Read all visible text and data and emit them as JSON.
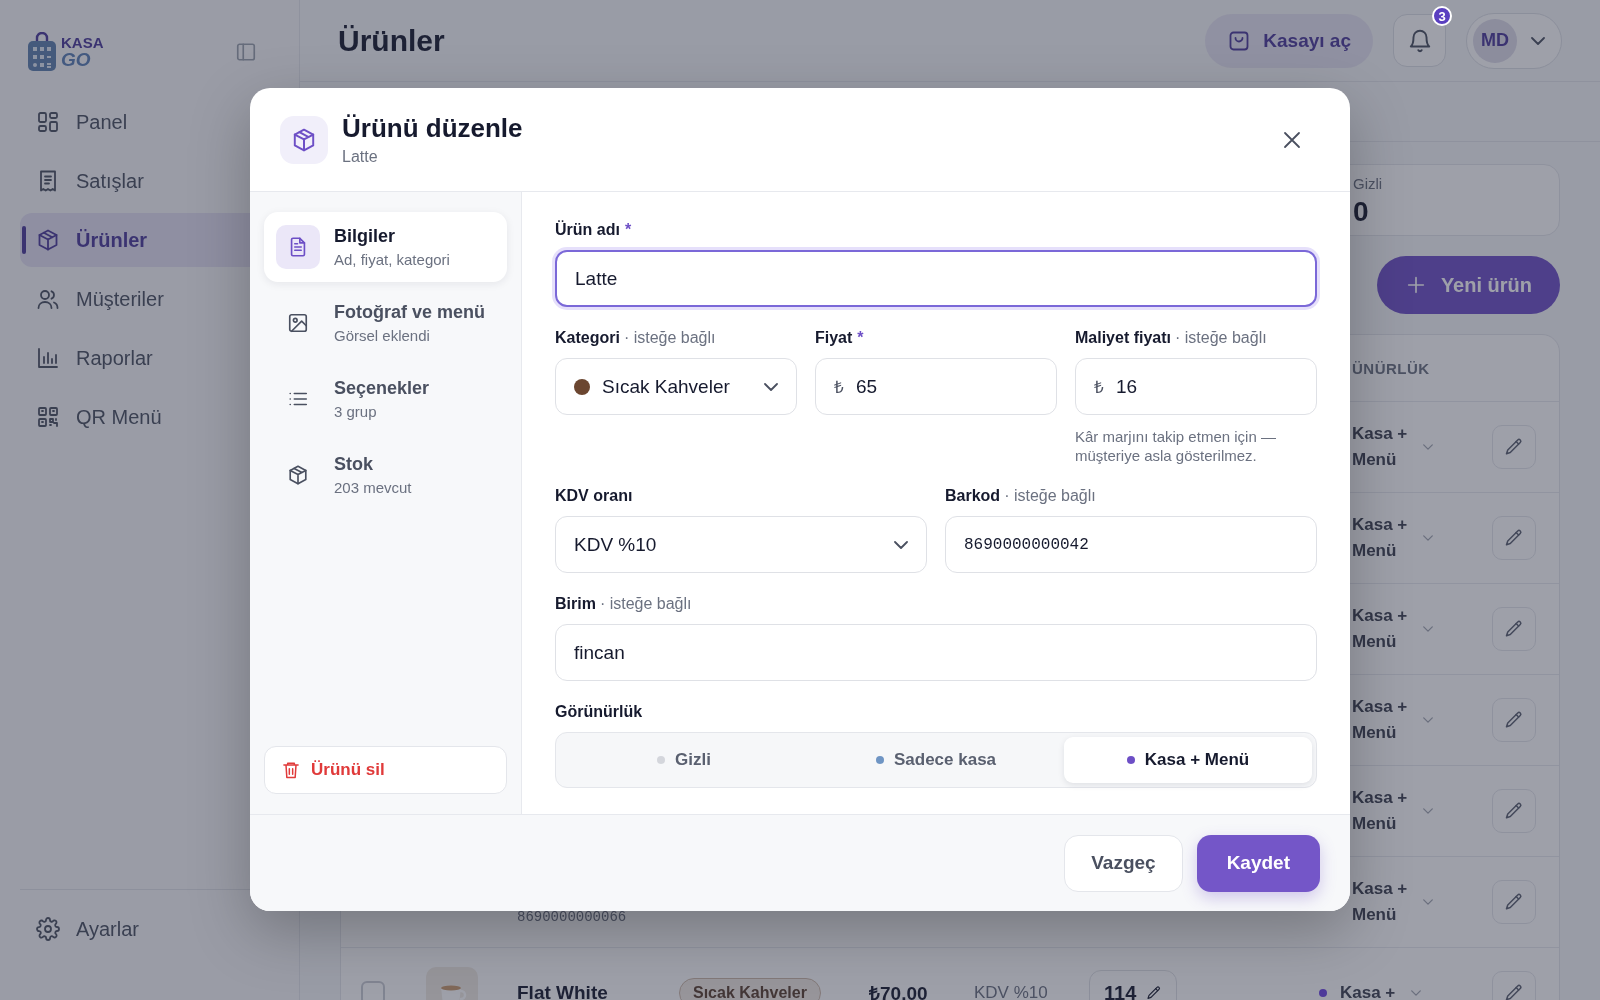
{
  "sidebar": {
    "logo": {
      "line_1": "KASA",
      "line_2": "GO"
    },
    "items": [
      {
        "label": "Panel",
        "selected": false
      },
      {
        "label": "Satışlar",
        "selected": false
      },
      {
        "label": "Ürünler",
        "selected": true
      },
      {
        "label": "Müşteriler",
        "selected": false
      },
      {
        "label": "Raporlar",
        "selected": false
      },
      {
        "label": "QR Menü",
        "selected": false
      }
    ],
    "footer_item": {
      "label": "Ayarlar"
    }
  },
  "header": {
    "title": "Ürünler",
    "open_register_button": "Kasayı aç",
    "notification_count": "3",
    "avatar_initials": "MD"
  },
  "stats": [
    {
      "label": "Gizli",
      "value": "0"
    }
  ],
  "new_product_button": "Yeni ürün",
  "table": {
    "columns": [
      {
        "label": "ÜNÜRLÜK"
      }
    ],
    "rows": [
      {
        "visibility": "Kasa + Menü"
      },
      {
        "visibility": "Kasa + Menü"
      },
      {
        "visibility": "Kasa + Menü"
      },
      {
        "visibility": "Kasa + Menü"
      },
      {
        "visibility": "Kasa + Menü"
      },
      {
        "barcode": "8690000000066",
        "visibility": "Kasa + Menü"
      },
      {
        "checked": false,
        "name": "Flat White",
        "category": "Sıcak Kahveler",
        "price": "₺70.00",
        "vat": "KDV %10",
        "stock": "114",
        "visibility": "Kasa +",
        "color": "#4e3a9a"
      }
    ]
  },
  "modal": {
    "title": "Ürünü düzenle",
    "subtitle": "Latte",
    "sections": [
      {
        "title": "Bilgiler",
        "subtitle": "Ad, fiyat, kategori",
        "selected": true
      },
      {
        "title": "Fotoğraf ve menü",
        "subtitle": "Görsel eklendi",
        "selected": false
      },
      {
        "title": "Seçenekler",
        "subtitle": "3 grup",
        "selected": false
      },
      {
        "title": "Stok",
        "subtitle": "203 mevcut",
        "selected": false
      }
    ],
    "delete_button": "Ürünü sil",
    "field_rows": [
      [
        {
          "kind": "text",
          "label": "Ürün adı",
          "required_mark": "*",
          "value": "Latte",
          "focused": true
        }
      ],
      [
        {
          "kind": "select",
          "label": "Kategori",
          "note": "· isteğe bağlı",
          "value": "Sıcak Kahveler",
          "color": "#6b4630",
          "focused": false
        },
        {
          "kind": "money",
          "label": "Fiyat",
          "required_mark": "*",
          "prefix": "₺",
          "value": "65",
          "focused": false
        },
        {
          "kind": "money",
          "label": "Maliyet fiyatı",
          "note": "· isteğe bağlı",
          "prefix": "₺",
          "value": "16",
          "focused": false,
          "hint": "Kâr marjını takip etmen için — müşteriye asla gösterilmez."
        }
      ],
      [
        {
          "kind": "select",
          "label": "KDV oranı",
          "value": "KDV %10",
          "focused": false
        },
        {
          "kind": "code",
          "label": "Barkod",
          "note": "· isteğe bağlı",
          "value": "8690000000042",
          "focused": false
        }
      ],
      [
        {
          "kind": "text",
          "label": "Birim",
          "note": "· isteğe bağlı",
          "value": "fincan",
          "focused": false
        }
      ]
    ],
    "visibility": {
      "label": "Görünürlük",
      "options": [
        {
          "label": "Gizli",
          "color": "#d4d6dc",
          "selected": false
        },
        {
          "label": "Sadece kasa",
          "color": "#6f95c4",
          "selected": false
        },
        {
          "label": "Kasa + Menü",
          "color": "#6d4fc6",
          "selected": true
        }
      ]
    },
    "cancel_button": "Vazgeç",
    "save_button": "Kaydet"
  }
}
